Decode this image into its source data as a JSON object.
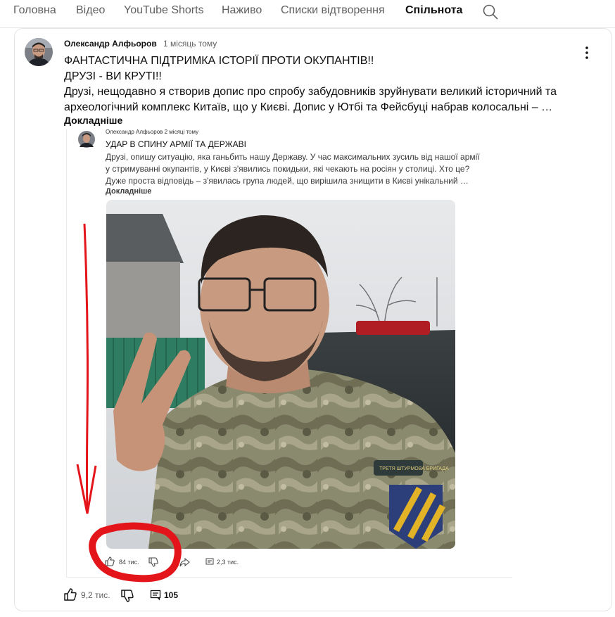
{
  "tabs": [
    "Головна",
    "Відео",
    "YouTube Shorts",
    "Наживо",
    "Списки відтворення",
    "Спільнота"
  ],
  "active_tab": "Спільнота",
  "post": {
    "author": "Олександр Алфьоров",
    "time": "1 місяць тому",
    "lines": [
      "ФАНТАСТИЧНА ПІДТРИМКА ІСТОРІЇ ПРОТИ ОКУПАНТІВ!!",
      "ДРУЗІ - ВИ КРУТІ!!",
      "Друзі, нещодавно я створив допис про спробу забудовників зруйнувати великий історичний та",
      "археологічний комплекс Китаїв, що у Києві. Допис у Ютбі та Фейсбуці набрав колосальні – …"
    ],
    "more_label": "Докладніше",
    "likes": "9,2 тис.",
    "comments": "105"
  },
  "embedded": {
    "header": "Олександр Алфьоров   2 місяці тому",
    "lines": [
      "УДАР В СПИНУ АРМІЇ ТА ДЕРЖАВІ",
      "Друзі, опишу ситуацію, яка ганьбить нашу Державу. У час максимальних зусиль від нашої армії",
      "у стримуванні окупантів, у Києві з'явились покидьки, які чекають на росіян у столиці. Хто це?",
      "Дуже проста відповідь – з'явилась група людей, що вирішила знищити в Києві унікальний …"
    ],
    "more_label": "Докладніше",
    "likes": "84 тис.",
    "comments": "2,3 тис.",
    "patch_text": "ТРЕТЯ ШТУРМОВА БРИГАДА"
  },
  "colors": {
    "annotation": "#e3151b",
    "active_tab_underline": "#0f0f0f"
  },
  "icons": [
    "search-icon",
    "more-vert-icon",
    "thumb-up-icon",
    "thumb-down-icon",
    "comment-icon",
    "share-icon"
  ]
}
